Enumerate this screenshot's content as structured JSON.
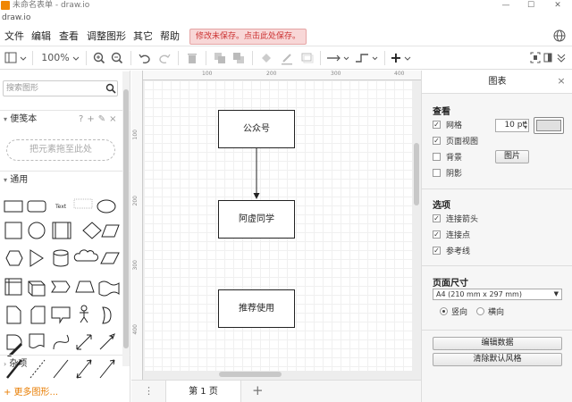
{
  "window": {
    "title": "未命名表单 - draw.io",
    "app_name": "draw.io",
    "minimize_glyph": "—",
    "maximize_glyph": "☐",
    "close_glyph": "✕"
  },
  "menu": {
    "items": [
      "文件",
      "编辑",
      "查看",
      "调整图形",
      "其它",
      "帮助"
    ],
    "save_warning": "修改未保存。点击此处保存。"
  },
  "toolbar": {
    "zoom": "100%",
    "add_label": "+"
  },
  "sidebar": {
    "search_placeholder": "搜索图形",
    "scratchpad_title": "便笺本",
    "scratchpad_actions": [
      "?",
      "+",
      "✎",
      "×"
    ],
    "dropzone_text": "把元素拖至此处",
    "general_title": "通用",
    "shape_text_label": "Text",
    "misc_title": "杂项",
    "more_shapes": "+ 更多图形..."
  },
  "canvas": {
    "ruler_top": [
      "100",
      "200",
      "300",
      "400"
    ],
    "ruler_left": [
      "100",
      "200",
      "300",
      "400"
    ],
    "nodes": [
      {
        "label": "公众号"
      },
      {
        "label": "阿虚同学"
      },
      {
        "label": "推荐使用"
      }
    ],
    "page_tab": "第 1 页",
    "page_menu_glyph": "⋮",
    "add_page_glyph": "+"
  },
  "panel": {
    "title": "图表",
    "close_glyph": "×",
    "view_title": "查看",
    "view_options": [
      {
        "label": "网格",
        "checked": true
      },
      {
        "label": "页面视图",
        "checked": true
      },
      {
        "label": "背景",
        "checked": false
      },
      {
        "label": "阴影",
        "checked": false
      }
    ],
    "grid_size": "10 pt",
    "image_button": "图片",
    "options_title": "选项",
    "options": [
      {
        "label": "连接箭头",
        "checked": true
      },
      {
        "label": "连接点",
        "checked": true
      },
      {
        "label": "参考线",
        "checked": true
      }
    ],
    "page_size_title": "页面尺寸",
    "page_size": "A4 (210 mm x 297 mm)",
    "orientation": [
      {
        "label": "竖向",
        "selected": true
      },
      {
        "label": "横向",
        "selected": false
      }
    ],
    "edit_data_button": "编辑数据",
    "clear_style_button": "清除默认风格"
  },
  "colors": {
    "accent": "#e87e04",
    "warning_bg": "#f8d7d7",
    "warning_text": "#cc3333"
  }
}
